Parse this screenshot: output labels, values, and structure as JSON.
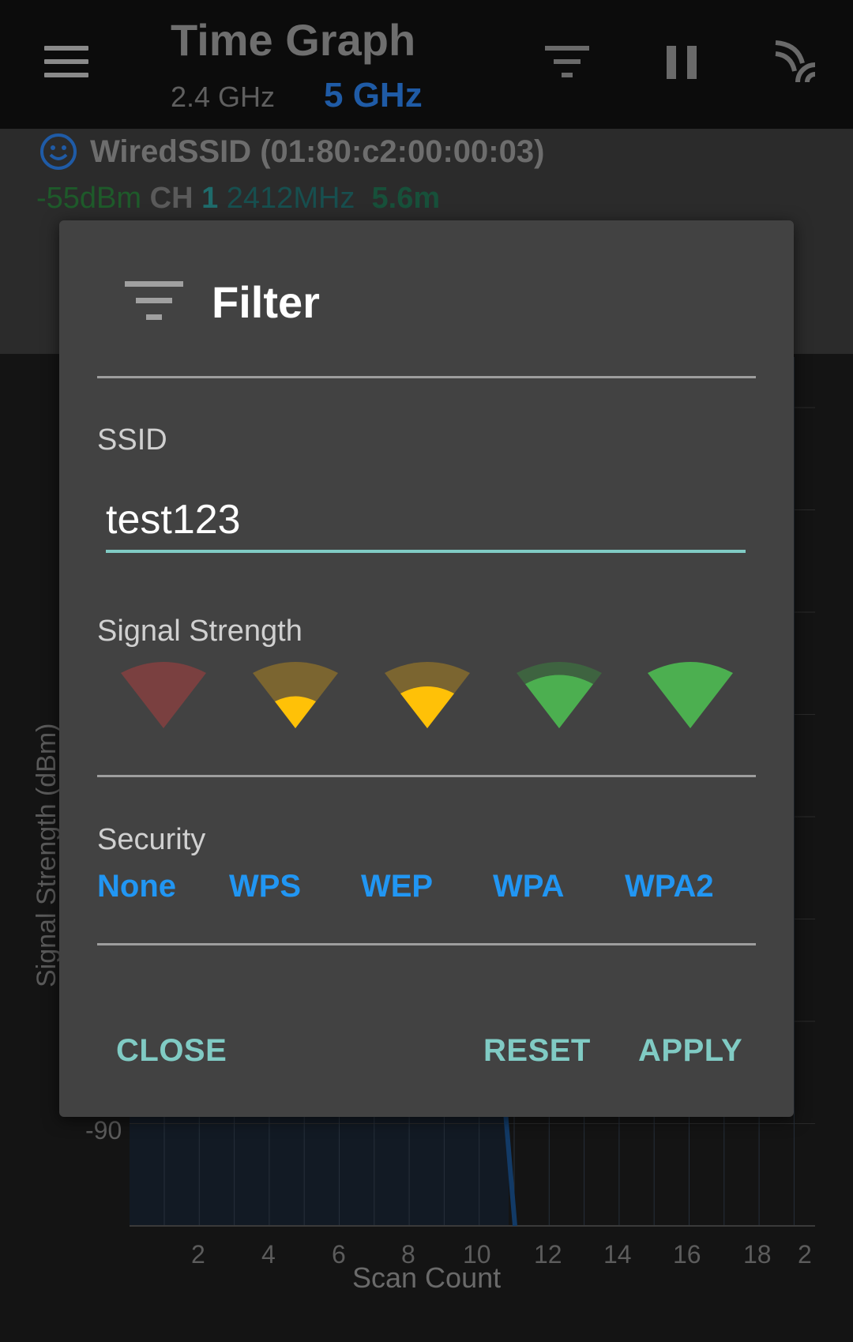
{
  "app_bar": {
    "title": "Time Graph",
    "band_2_4": "2.4 GHz",
    "band_5": "5 GHz",
    "icons": [
      "menu-icon",
      "filter-icon",
      "pause-icon",
      "wifi-scan-icon"
    ]
  },
  "network": {
    "ssid": "WiredSSID (01:80:c2:00:00:03)",
    "signal": "-55dBm",
    "ch_label": "CH",
    "channel": "1",
    "frequency": "2412MHz",
    "distance": "5.6m"
  },
  "graph": {
    "y_axis_label": "Signal Strength (dBm)",
    "y_ticks": [
      "-90"
    ],
    "x_axis_label": "Scan Count",
    "x_ticks": [
      "2",
      "4",
      "6",
      "8",
      "10",
      "12",
      "14",
      "16",
      "18",
      "2"
    ]
  },
  "dialog": {
    "title": "Filter",
    "ssid_label": "SSID",
    "ssid_value": "test123",
    "signal_label": "Signal Strength",
    "signal_levels": [
      0,
      1,
      2,
      3,
      4
    ],
    "security_label": "Security",
    "security_options": [
      "None",
      "WPS",
      "WEP",
      "WPA",
      "WPA2"
    ],
    "buttons": {
      "close": "CLOSE",
      "reset": "RESET",
      "apply": "APPLY"
    }
  },
  "colors": {
    "accent_teal": "#80cbc4",
    "accent_blue": "#2196f3",
    "signal_red": "#7a4040",
    "signal_yellow": "#ffc107",
    "signal_green": "#4caf50"
  }
}
